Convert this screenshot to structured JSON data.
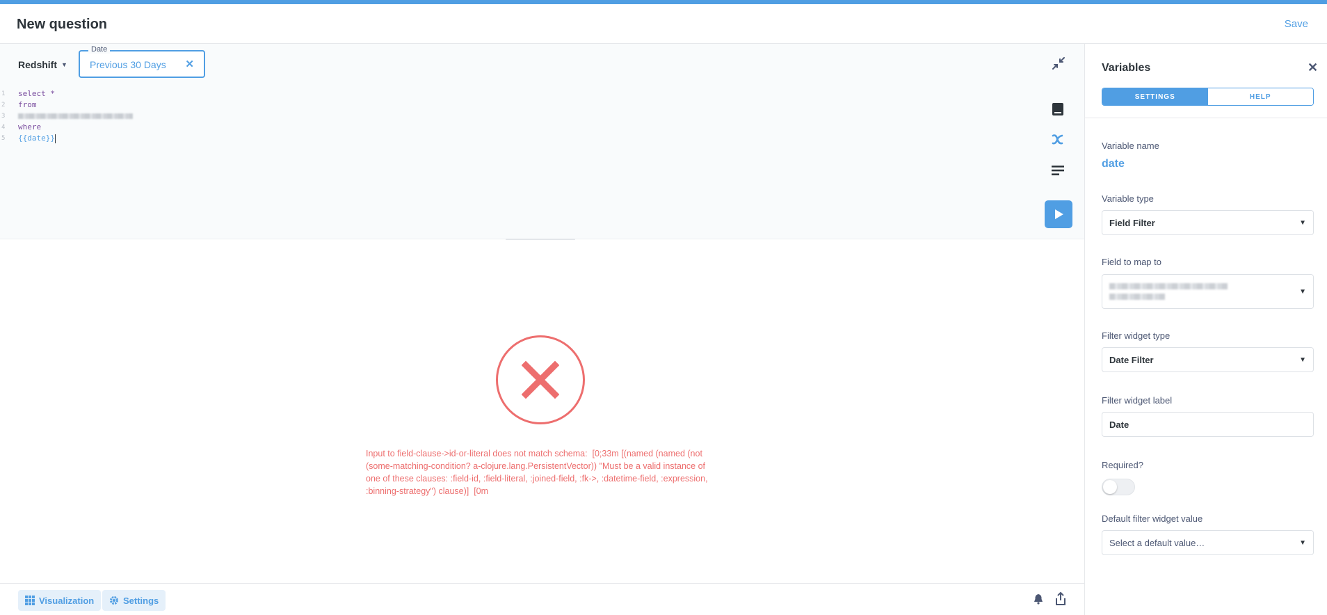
{
  "header": {
    "title": "New question",
    "save_label": "Save"
  },
  "editor": {
    "database": "Redshift",
    "date_widget": {
      "legend": "Date",
      "value": "Previous 30 Days"
    },
    "lines": [
      {
        "num": "1",
        "text": "select *"
      },
      {
        "num": "2",
        "text": "from"
      },
      {
        "num": "3",
        "text": ""
      },
      {
        "num": "4",
        "text": "where"
      },
      {
        "num": "5",
        "text": "{{date}}"
      }
    ]
  },
  "results": {
    "error_message": "Input to field-clause->id-or-literal does not match schema:  [0;33m [(named (named (not (some-matching-condition? a-clojure.lang.PersistentVector)) \"Must be a valid instance of one of these clauses: :field-id, :field-literal, :joined-field, :fk->, :datetime-field, :expression, :binning-strategy\") clause)]  [0m"
  },
  "footer": {
    "visualization_label": "Visualization",
    "settings_label": "Settings"
  },
  "sidebar": {
    "title": "Variables",
    "tabs": [
      "SETTINGS",
      "HELP"
    ],
    "variable_name_label": "Variable name",
    "variable_name": "date",
    "variable_type_label": "Variable type",
    "variable_type": "Field Filter",
    "field_map_label": "Field to map to",
    "widget_type_label": "Filter widget type",
    "widget_type": "Date Filter",
    "widget_label_label": "Filter widget label",
    "widget_label_value": "Date",
    "required_label": "Required?",
    "required": false,
    "default_value_label": "Default filter widget value",
    "default_value_placeholder": "Select a default value…"
  },
  "colors": {
    "brand": "#509ee3",
    "error": "#ed6e6e",
    "text": "#2e353b"
  }
}
